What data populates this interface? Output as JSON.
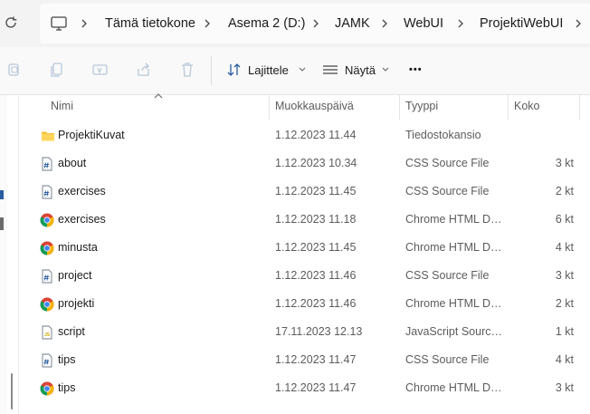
{
  "breadcrumb": [
    "Tämä tietokone",
    "Asema 2 (D:)",
    "JAMK",
    "WebUI",
    "ProjektiWebUI"
  ],
  "toolbar": {
    "sort_label": "Lajittele",
    "view_label": "Näytä",
    "more_label": "•••"
  },
  "columns": {
    "name": "Nimi",
    "modified": "Muokkauspäivä",
    "type": "Tyyppi",
    "size": "Koko"
  },
  "files": [
    {
      "icon": "folder-icon",
      "name": "ProjektiKuvat",
      "modified": "1.12.2023 11.44",
      "type": "Tiedostokansio",
      "size": ""
    },
    {
      "icon": "css-file-icon",
      "name": "about",
      "modified": "1.12.2023 10.34",
      "type": "CSS Source File",
      "size": "3 kt"
    },
    {
      "icon": "css-file-icon",
      "name": "exercises",
      "modified": "1.12.2023 11.45",
      "type": "CSS Source File",
      "size": "2 kt"
    },
    {
      "icon": "chrome-icon",
      "name": "exercises",
      "modified": "1.12.2023 11.18",
      "type": "Chrome HTML Document",
      "size": "6 kt"
    },
    {
      "icon": "chrome-icon",
      "name": "minusta",
      "modified": "1.12.2023 11.45",
      "type": "Chrome HTML Document",
      "size": "4 kt"
    },
    {
      "icon": "css-file-icon",
      "name": "project",
      "modified": "1.12.2023 11.46",
      "type": "CSS Source File",
      "size": "3 kt"
    },
    {
      "icon": "chrome-icon",
      "name": "projekti",
      "modified": "1.12.2023 11.46",
      "type": "Chrome HTML Document",
      "size": "2 kt"
    },
    {
      "icon": "js-file-icon",
      "name": "script",
      "modified": "17.11.2023 12.13",
      "type": "JavaScript Source File",
      "size": "1 kt"
    },
    {
      "icon": "css-file-icon",
      "name": "tips",
      "modified": "1.12.2023 11.47",
      "type": "CSS Source File",
      "size": "4 kt"
    },
    {
      "icon": "chrome-icon",
      "name": "tips",
      "modified": "1.12.2023 11.47",
      "type": "Chrome HTML Document",
      "size": "3 kt"
    }
  ]
}
